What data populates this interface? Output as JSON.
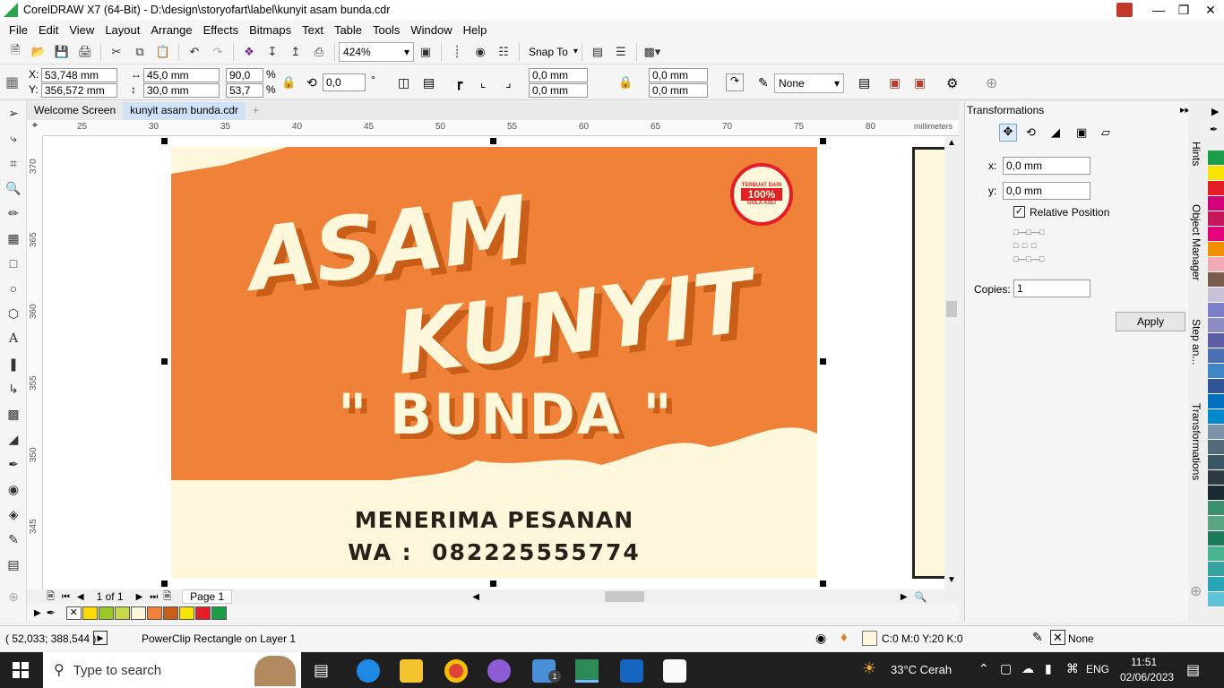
{
  "window": {
    "title": "CorelDRAW X7 (64-Bit) - D:\\design\\storyofart\\label\\kunyit asam bunda.cdr"
  },
  "menu": [
    "File",
    "Edit",
    "View",
    "Layout",
    "Arrange",
    "Effects",
    "Bitmaps",
    "Text",
    "Table",
    "Tools",
    "Window",
    "Help"
  ],
  "toolbar": {
    "zoom": "424%",
    "snap_to": "Snap To"
  },
  "properties": {
    "x": "53,748 mm",
    "y": "356,572 mm",
    "width": "45,0 mm",
    "height": "30,0 mm",
    "scale_w": "90,0",
    "scale_h": "53,7",
    "percent": "%",
    "rotation": "0,0",
    "degree": "°",
    "off_x1": "0,0 mm",
    "off_y1": "0,0 mm",
    "off_x2": "0,0 mm",
    "off_y2": "0,0 mm",
    "outline": "None"
  },
  "tabs": [
    "Welcome Screen",
    "kunyit asam bunda.cdr"
  ],
  "ruler": {
    "units": "millimeters",
    "h_ticks": [
      "25",
      "30",
      "35",
      "40",
      "45",
      "50",
      "55",
      "60",
      "65",
      "70",
      "75",
      "80"
    ],
    "v_ticks": [
      "370",
      "365",
      "360",
      "355",
      "350",
      "345"
    ]
  },
  "artwork": {
    "line1": "ASAM",
    "line2": "KUNYIT",
    "line3": "\" BUNDA \"",
    "badge_top": "TERBUAT DARI",
    "badge_mid": "100%",
    "badge_bottom": "GULA ASLI",
    "contact1": "MENERIMA PESANAN",
    "contact2": "WA :  082225555774"
  },
  "page_nav": {
    "count": "1 of 1",
    "page": "Page 1"
  },
  "docker": {
    "title": "Transformations",
    "x_label": "x:",
    "x_value": "0,0 mm",
    "y_label": "y:",
    "y_value": "0,0 mm",
    "relative": "Relative Position",
    "copies_label": "Copies:",
    "copies_value": "1",
    "apply": "Apply",
    "side_tabs": [
      "Hints",
      "Object Manager",
      "Step an...",
      "Transformations"
    ]
  },
  "status": {
    "coords": "( 52,033; 388,544 )",
    "object": "PowerClip Rectangle on Layer 1",
    "fill": "C:0 M:0 Y:20 K:0",
    "outline": "None"
  },
  "taskbar": {
    "search": "Type to search",
    "weather": "33°C  Cerah",
    "lang": "ENG",
    "time": "11:51",
    "date": "02/06/2023",
    "mail_badge": "1"
  },
  "colors": {
    "orange": "#ef8238",
    "cream": "#fdf8dc",
    "shadow": "#c85e18",
    "palette": [
      "#1a9e4a",
      "#f7e400",
      "#e41e26",
      "#d4007a",
      "#c2185b",
      "#e6007e",
      "#f29100",
      "#f4a9b8",
      "#7a5c4f",
      "#c9c1d9",
      "#7b7fc7",
      "#8e8bc2",
      "#5b5ea6",
      "#4a6fb5",
      "#3f86c6",
      "#2f5597",
      "#0070c0",
      "#0089cf",
      "#7b93a6",
      "#506a7c",
      "#3a5564",
      "#2b3b44",
      "#1a2a33",
      "#3a8f6c",
      "#5aa582",
      "#1d7a5a",
      "#49b28e",
      "#36a3a0",
      "#28a6b8",
      "#5ec3d6"
    ],
    "doc_palette": [
      "#ffd800",
      "#9bc925",
      "#c8d84a",
      "#fdf8dc",
      "#ef8238",
      "#c85e18",
      "#f7e400",
      "#e41e26",
      "#1a9e4a"
    ]
  }
}
